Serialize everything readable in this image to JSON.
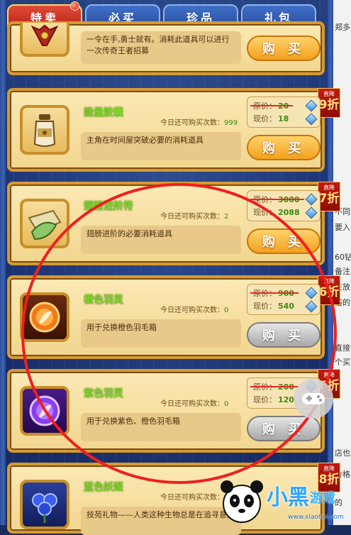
{
  "tabs": [
    "特卖",
    "必买",
    "珍品",
    "礼包"
  ],
  "active_tab": "特卖",
  "common": {
    "limit_label": "今日还可购买次数：",
    "orig_label": "原价：",
    "now_label": "现价：",
    "buy_label": "购 买",
    "badge_top": "直降"
  },
  "items": [
    {
      "name": "",
      "desc": "一令在手,勇士就有。消耗此道具可以进行一次传奇王者招募",
      "buy_state": "active"
    },
    {
      "name": "能量胶囊",
      "limit": "999",
      "desc": "主角在时间屋突破必要的消耗道具",
      "orig_price": "20",
      "now_price": "18",
      "discount": "9折",
      "buy_state": "active"
    },
    {
      "name": "翅膀进阶符",
      "limit": "2",
      "desc": "翅膀进阶的必要消耗道具",
      "orig_price": "3000",
      "now_price": "2088",
      "discount": "7折",
      "buy_state": "active"
    },
    {
      "name": "橙色羽灵",
      "limit": "0",
      "desc": "用于兑换橙色羽毛箱",
      "orig_price": "900",
      "now_price": "540",
      "discount": "6折",
      "buy_state": "disabled"
    },
    {
      "name": "紫色羽灵",
      "limit": "0",
      "desc": "用于兑换紫色、橙色羽毛箱",
      "orig_price": "200",
      "now_price": "120",
      "discount": "6折",
      "buy_state": "disabled"
    },
    {
      "name": "蓝色妖姬",
      "limit": "0",
      "desc": "技苑礼物——人类这种生物总是在追寻意义",
      "discount": "8折"
    }
  ],
  "right_strip": [
    "郑多",
    "不同",
    "要入",
    "60钻",
    "备注",
    "在放",
    "俗的",
    "直接",
    "个买",
    "店也",
    "价格",
    "的"
  ],
  "watermark": {
    "brand": "小黑",
    "brand2": "游戏",
    "url": "www.xiaohei.com"
  },
  "colors": {
    "accent_green": "#7fd92a",
    "circle_red": "#ee1f1f",
    "buy_orange": "#f2a11e",
    "badge_red": "#c41a10"
  }
}
